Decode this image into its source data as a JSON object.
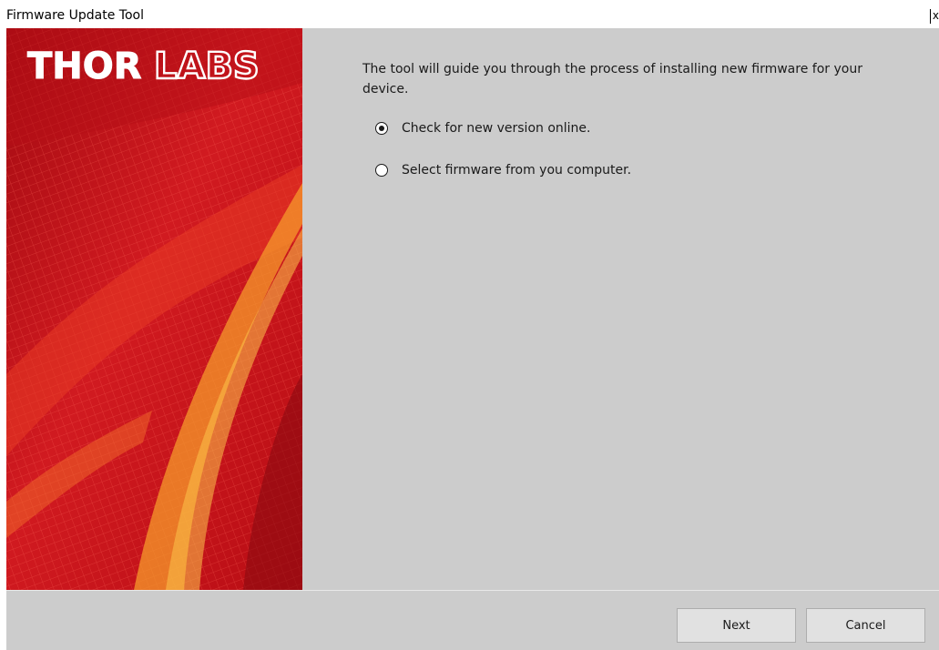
{
  "window": {
    "title": "Firmware Update Tool",
    "close_label": "x"
  },
  "banner": {
    "brand": "THORLABS",
    "colors": {
      "background": "#c4121b",
      "highlight": "#f5a623"
    }
  },
  "main": {
    "intro_text": "The tool will guide you through the process of installing new firmware for your device.",
    "options": [
      {
        "label": "Check for new version online.",
        "checked": true
      },
      {
        "label": "Select firmware from you computer.",
        "checked": false
      }
    ]
  },
  "footer": {
    "next_label": "Next",
    "cancel_label": "Cancel"
  },
  "colors": {
    "content_bg": "#cccccc",
    "button_bg": "#e1e1e1",
    "button_border": "#adadad"
  }
}
